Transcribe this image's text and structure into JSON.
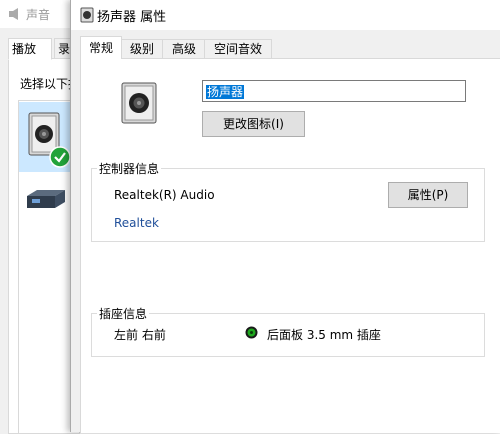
{
  "background_window": {
    "title": "声音",
    "tabs": [
      {
        "label": "播放"
      },
      {
        "label": "录"
      }
    ],
    "instruction": "选择以下播"
  },
  "dialog": {
    "title": "扬声器 属性",
    "tabs": [
      {
        "label": "常规",
        "active": true
      },
      {
        "label": "级别"
      },
      {
        "label": "高级"
      },
      {
        "label": "空间音效"
      }
    ],
    "device_name": "扬声器",
    "change_icon_button": "更改图标(I)",
    "controller_info": {
      "legend": "控制器信息",
      "controller_name": "Realtek(R) Audio",
      "properties_button": "属性(P)",
      "vendor_link": "Realtek"
    },
    "jack_info": {
      "legend": "插座信息",
      "channels": "左前 右前",
      "jack": "后面板 3.5 mm 插座",
      "jack_color": "#1ea81e"
    }
  },
  "colors": {
    "selection": "#0078d7",
    "link": "#1f4e99",
    "selected_item_bg": "#cce8ff",
    "check_green": "#22a33a"
  },
  "icons": {
    "speaker": "speaker-icon",
    "check": "check-circle-icon",
    "device": "audio-device-icon"
  }
}
